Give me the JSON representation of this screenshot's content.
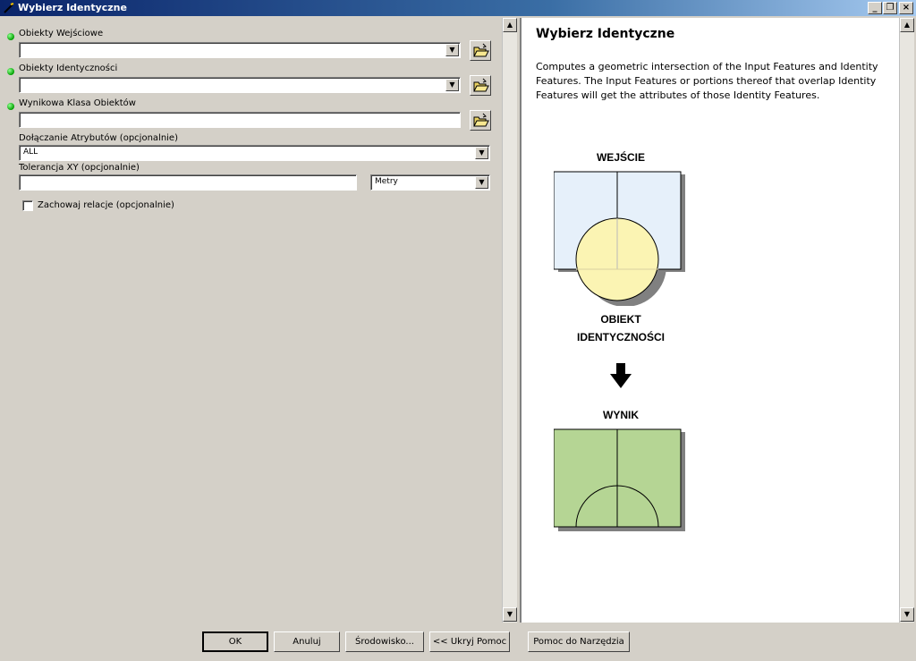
{
  "window": {
    "title": "Wybierz Identyczne"
  },
  "form": {
    "input_features_label": "Obiekty Wejściowe",
    "identity_features_label": "Obiekty Identyczności",
    "output_class_label": "Wynikowa Klasa Obiektów",
    "join_attributes_label": "Dołączanie Atrybutów (opcjonalnie)",
    "join_attributes_value": "ALL",
    "xy_tolerance_label": "Tolerancja XY (opcjonalnie)",
    "xy_tolerance_unit": "Metry",
    "keep_relationships_label": "Zachowaj relacje (opcjonalnie)",
    "keep_relationships_checked": false
  },
  "help": {
    "title": "Wybierz Identyczne",
    "description": "Computes a geometric intersection of the Input Features and Identity Features. The Input Features or portions thereof that overlap Identity Features will get the attributes of those Identity Features.",
    "figure": {
      "input_label": "WEJŚCIE",
      "identity_label_line1": "OBIEKT",
      "identity_label_line2": "IDENTYCZNOŚCI",
      "output_label": "WYNIK"
    }
  },
  "buttons": {
    "ok": "OK",
    "cancel": "Anuluj",
    "environment": "Środowisko...",
    "hide_help": "<< Ukryj Pomoc",
    "tool_help": "Pomoc do Narzędzia"
  },
  "colors": {
    "input_fill": "#e6f0fa",
    "identity_fill": "#fbf4b3",
    "output_fill": "#b5d594",
    "required_dot": "#00a000"
  }
}
